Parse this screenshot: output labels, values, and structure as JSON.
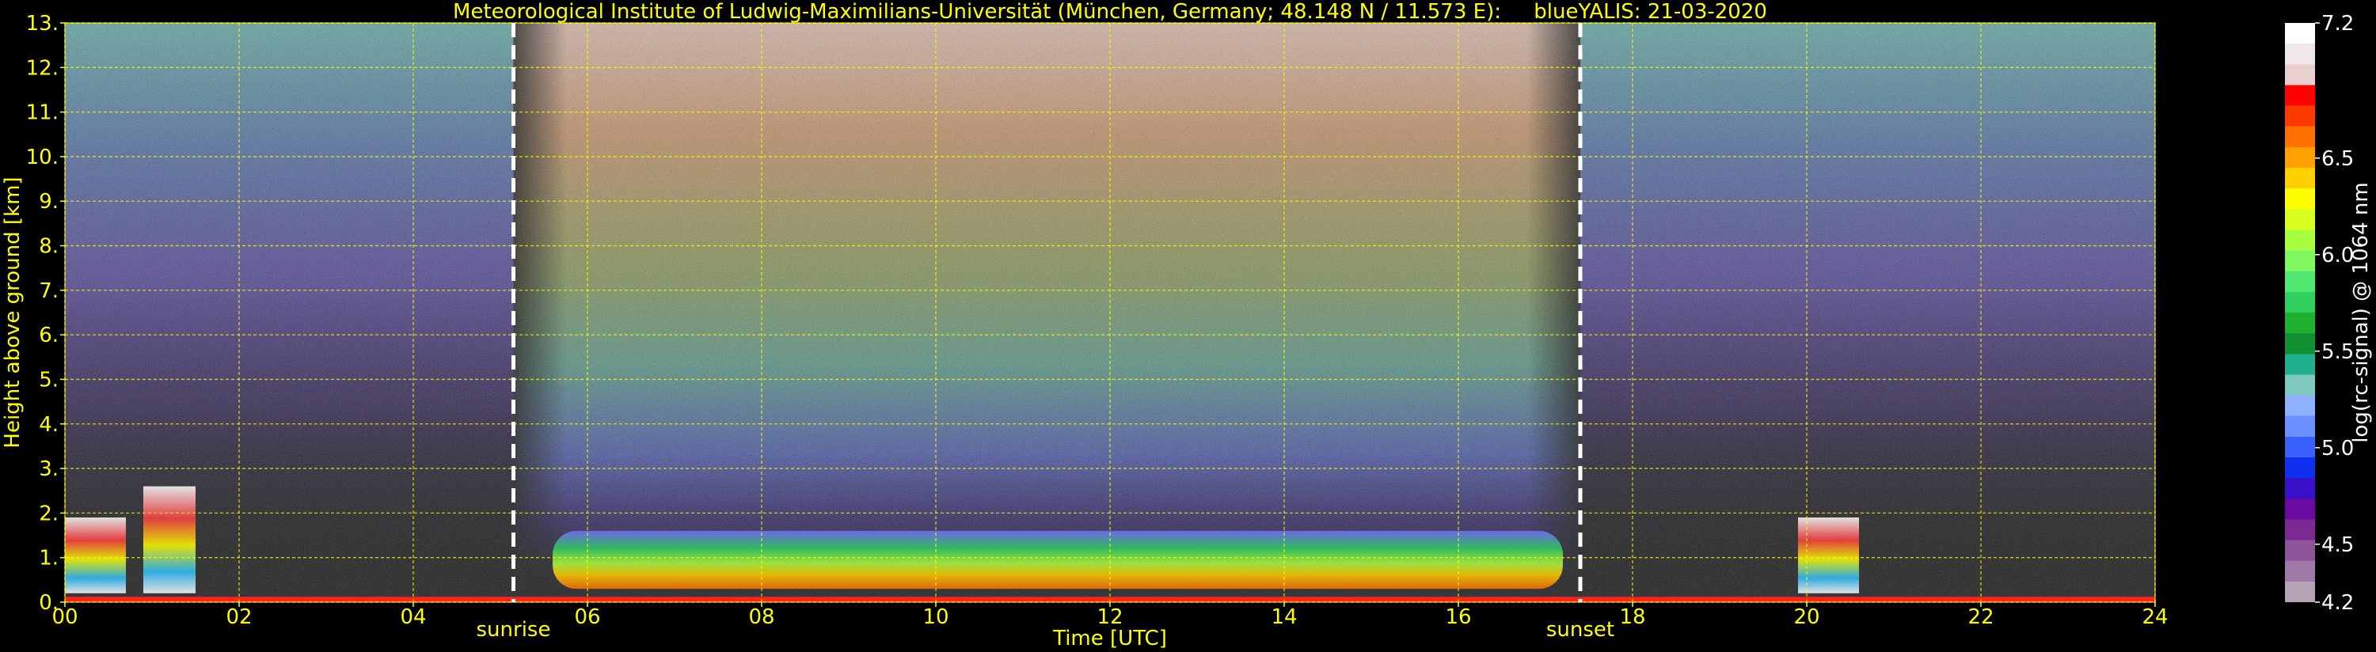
{
  "chart_data": {
    "type": "heatmap",
    "title": "Meteorological Institute of Ludwig-Maximilians-Universität (München, Germany; 48.148 N / 11.573 E):     blueYALIS: 21-03-2020",
    "xlabel": "Time [UTC]",
    "ylabel": "Height above ground [km]",
    "xlim": [
      0,
      24
    ],
    "ylim": [
      0,
      13
    ],
    "x_ticks": [
      0,
      2,
      4,
      6,
      8,
      10,
      12,
      14,
      16,
      18,
      20,
      22,
      24
    ],
    "x_tick_labels": [
      "00",
      "02",
      "04",
      "06",
      "08",
      "10",
      "12",
      "14",
      "16",
      "18",
      "20",
      "22",
      "24"
    ],
    "y_ticks": [
      0,
      1,
      2,
      3,
      4,
      5,
      6,
      7,
      8,
      9,
      10,
      11,
      12,
      13
    ],
    "y_tick_labels": [
      "0.",
      "1.",
      "2.",
      "3.",
      "4.",
      "5.",
      "6.",
      "7.",
      "8.",
      "9.",
      "10.",
      "11.",
      "12.",
      "13."
    ],
    "grid": true,
    "annotations": [
      {
        "label": "sunrise",
        "x": 5.15
      },
      {
        "label": "sunset",
        "x": 17.4
      }
    ],
    "colorbar": {
      "label": "log(rc-signal) @ 1064 nm",
      "range": [
        4.2,
        7.2
      ],
      "tick_values": [
        4.2,
        4.5,
        5.0,
        5.5,
        6.0,
        6.5,
        7.2
      ],
      "tick_labels": [
        "4.2",
        "4.5",
        "5.0",
        "5.5",
        "6.0",
        "6.5",
        "7.2"
      ],
      "colors": [
        "#b6a3b6",
        "#a07aa6",
        "#8c559a",
        "#7a2a90",
        "#6a0aa0",
        "#3a10c8",
        "#1030f0",
        "#3a60ff",
        "#6a90ff",
        "#8fb0ff",
        "#7fc8c0",
        "#20b090",
        "#109030",
        "#20b030",
        "#30d060",
        "#50e870",
        "#80f860",
        "#a8ff40",
        "#d8ff20",
        "#ffff00",
        "#ffd000",
        "#ffa000",
        "#ff7000",
        "#ff3a00",
        "#ff0000",
        "#e8d0d0",
        "#f0e8e8",
        "#ffffff"
      ]
    },
    "features": {
      "daytime_aerosol_layer_km": [
        0.3,
        1.6
      ],
      "daytime_aerosol_period_utc": [
        5.6,
        17.2
      ],
      "night_low_clouds_utc": [
        [
          0.0,
          0.7
        ],
        [
          0.9,
          1.5
        ],
        [
          19.9,
          20.6
        ]
      ],
      "night_low_cloud_top_km": [
        1.9,
        2.6,
        1.9
      ]
    }
  }
}
